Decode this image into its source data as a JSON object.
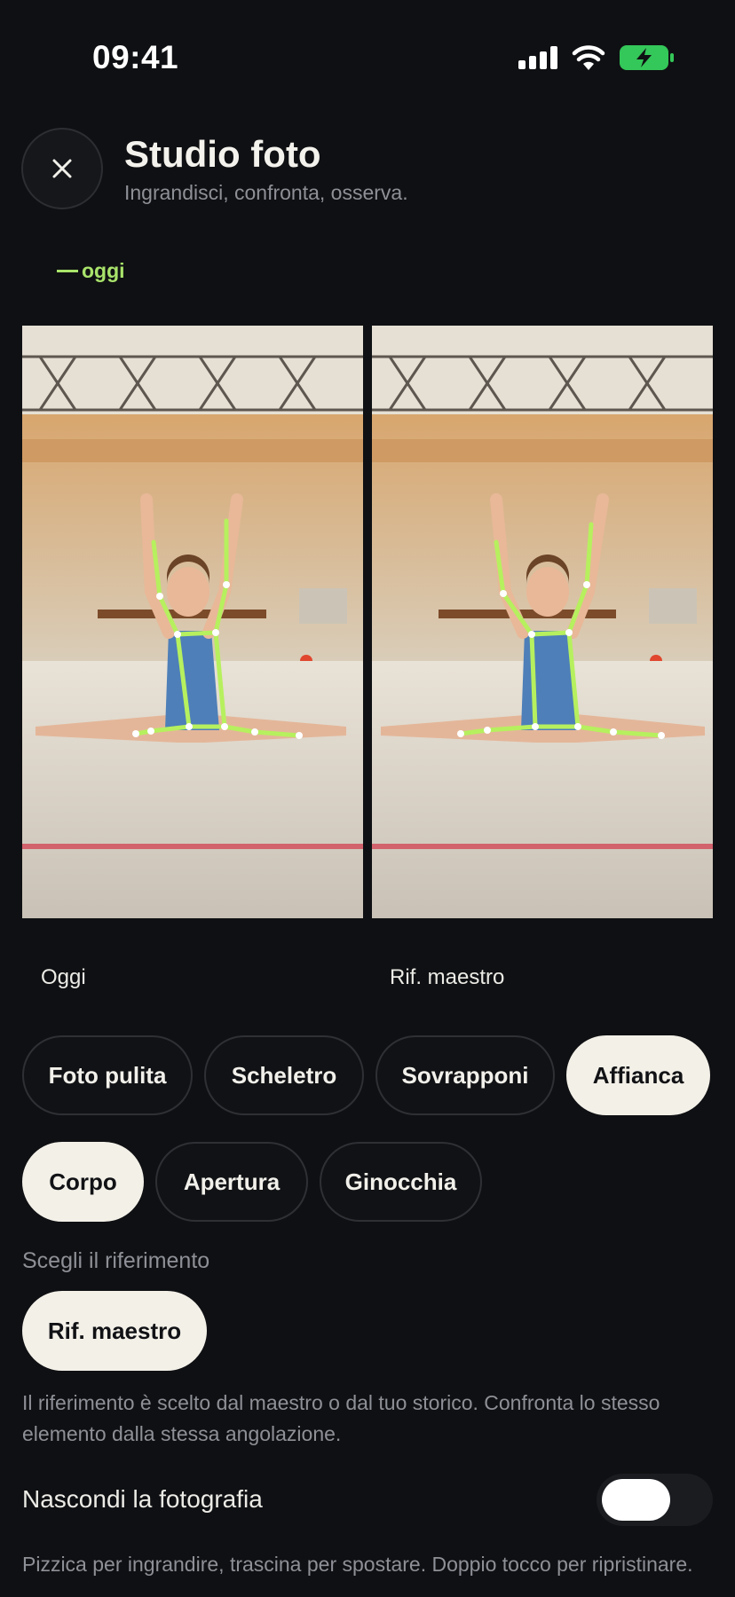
{
  "status_bar": {
    "time": "09:41"
  },
  "header": {
    "title": "Studio foto",
    "subtitle": "Ingrandisci, confronta, osserva."
  },
  "date_tag": "oggi",
  "photos": {
    "left_label": "Oggi",
    "right_label": "Rif. maestro"
  },
  "view_modes": [
    "Foto pulita",
    "Scheletro",
    "Sovrapponi",
    "Affianca"
  ],
  "active_view_mode": "Affianca",
  "focus_areas": [
    "Corpo",
    "Apertura",
    "Ginocchia"
  ],
  "active_focus_area": "Corpo",
  "reference": {
    "label": "Scegli il riferimento",
    "selected": "Rif. maestro",
    "note": "Il riferimento è scelto dal maestro o dal tuo storico. Confronta lo stesso elemento dalla stessa angolazione."
  },
  "hide_photo": {
    "label": "Nascondi la fotografia",
    "enabled": false
  },
  "hint": "Pizzica per ingrandire, trascina per spostare. Doppio tocco per ripristinare.",
  "colors": {
    "accent": "#a9e36b",
    "background": "#0f1013",
    "chip_active": "#f3f0e8",
    "skeleton": "#b6f05e"
  },
  "icons": [
    "signal-icon",
    "wifi-icon",
    "battery-charging-icon",
    "close-icon"
  ]
}
